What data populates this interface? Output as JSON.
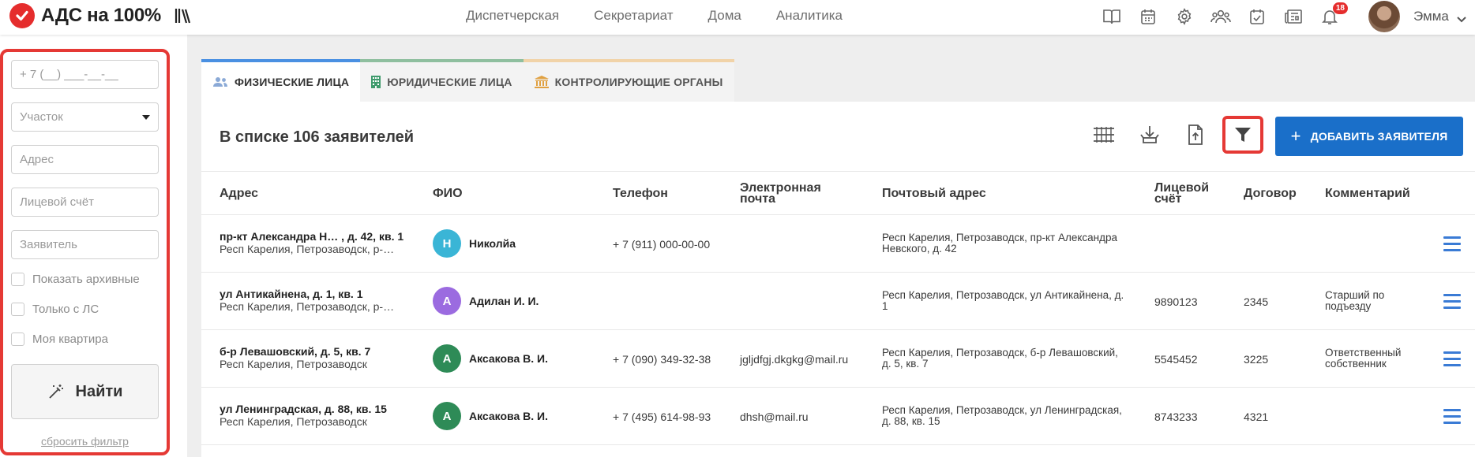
{
  "app": {
    "logo_text": "АДС на 100%",
    "brand_color": "#e52d2d"
  },
  "nav": [
    "Диспетчерская",
    "Секретариат",
    "Дома",
    "Аналитика"
  ],
  "header": {
    "notifications_count": "18",
    "user_name": "Эмма",
    "icons": [
      "book-icon",
      "calendar-icon",
      "settings-icon",
      "users-icon",
      "calendar-check-icon",
      "newspaper-icon",
      "bell-icon"
    ]
  },
  "filter": {
    "phone_placeholder": "+ 7 (__) ___-__-__",
    "area_placeholder": "Участок",
    "address_placeholder": "Адрес",
    "account_placeholder": "Лицевой счёт",
    "applicant_placeholder": "Заявитель",
    "checkboxes": [
      "Показать архивные",
      "Только с ЛС",
      "Моя квартира"
    ],
    "find_label": "Найти",
    "reset_label": "сбросить фильтр"
  },
  "tabs": [
    {
      "label": "ФИЗИЧЕСКИЕ ЛИЦА",
      "color": "#4a90e2"
    },
    {
      "label": "ЮРИДИЧЕСКИЕ ЛИЦА",
      "color": "#8fbf9f"
    },
    {
      "label": "КОНТРОЛИРУЮЩИЕ ОРГАНЫ",
      "color": "#f1d3a8"
    }
  ],
  "list": {
    "title": "В списке 106 заявителей",
    "add_button": "ДОБАВИТЬ ЗАЯВИТЕЛЯ"
  },
  "columns": [
    "Адрес",
    "ФИО",
    "Телефон",
    "Электронная почта",
    "Почтовый адрес",
    "Лицевой счёт",
    "Договор",
    "Комментарий"
  ],
  "rows": [
    {
      "addr1": "пр-кт Александра Н…  , д. 42, кв. 1",
      "addr2": "Респ Карелия, Петрозаводск, р-…",
      "initial": "Н",
      "avatar_color": "#3ab5d6",
      "fio": "Николйа",
      "phone": "+ 7 (911) 000-00-00",
      "email": "",
      "postal": "Респ Карелия, Петрозаводск, пр-кт Александра Невского, д. 42",
      "account": "",
      "contract": "",
      "comment": ""
    },
    {
      "addr1": "ул Антикайнена, д. 1, кв. 1",
      "addr2": "Респ Карелия, Петрозаводск, р-…",
      "initial": "А",
      "avatar_color": "#9b6be0",
      "fio": "Адилан И. И.",
      "phone": "",
      "email": "",
      "postal": "Респ Карелия, Петрозаводск, ул Антикайнена, д. 1",
      "account": "9890123",
      "contract": "2345",
      "comment": "Старший по подъезду"
    },
    {
      "addr1": "б-р Левашовский, д. 5, кв. 7",
      "addr2": "Респ Карелия, Петрозаводск",
      "initial": "А",
      "avatar_color": "#2e8b57",
      "fio": "Аксакова В. И.",
      "phone": "+ 7 (090) 349-32-38",
      "email": "jgljdfgj.dkgkg@mail.ru",
      "postal": "Респ Карелия, Петрозаводск, б-р Левашовский, д. 5, кв. 7",
      "account": "5545452",
      "contract": "3225",
      "comment": "Ответственный собственник"
    },
    {
      "addr1": "ул Ленинградская, д. 88, кв. 15",
      "addr2": "Респ Карелия, Петрозаводск",
      "initial": "А",
      "avatar_color": "#2e8b57",
      "fio": "Аксакова В. И.",
      "phone": "+ 7 (495) 614-98-93",
      "email": "dhsh@mail.ru",
      "postal": "Респ Карелия, Петрозаводск, ул Ленинградская, д. 88, кв. 15",
      "account": "8743233",
      "contract": "4321",
      "comment": ""
    }
  ]
}
